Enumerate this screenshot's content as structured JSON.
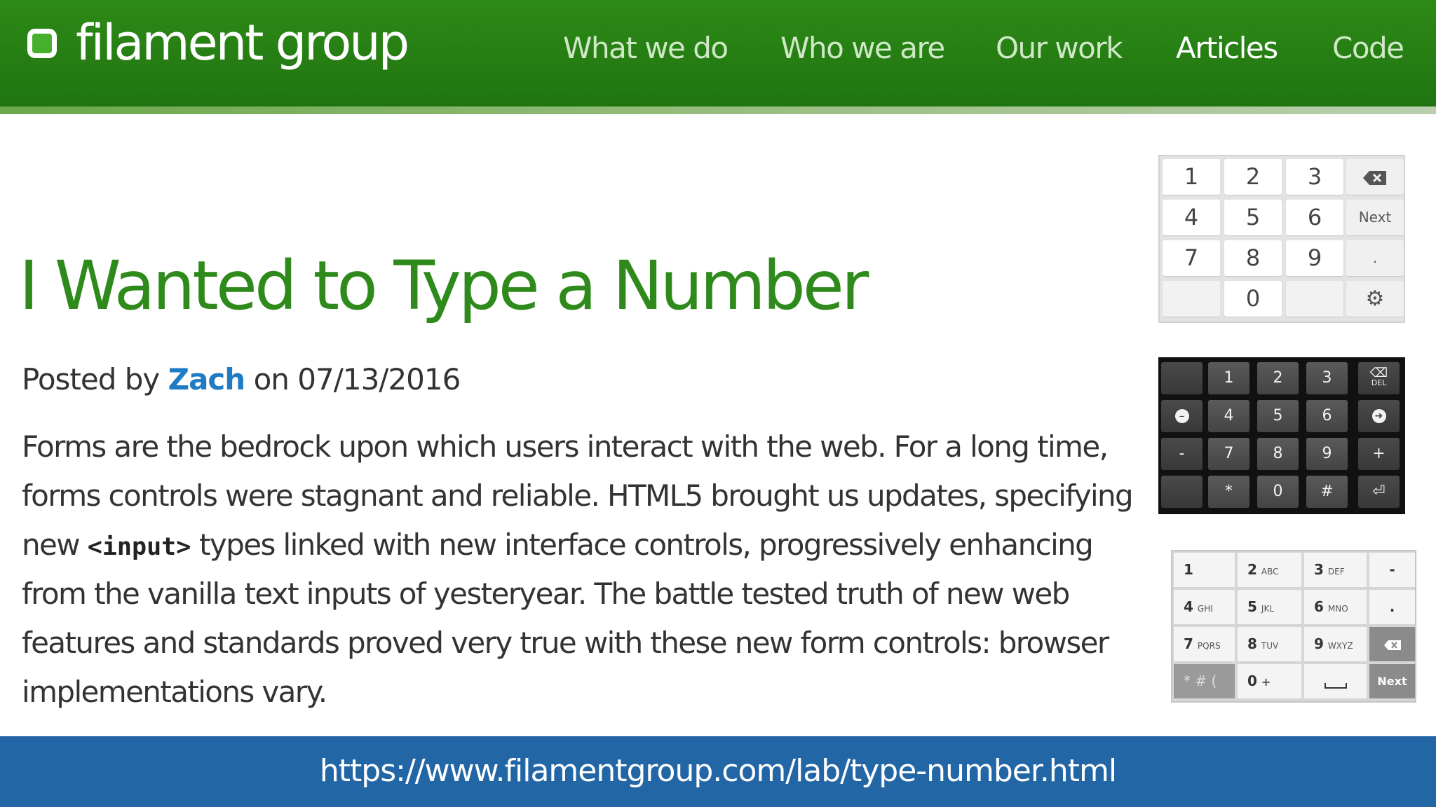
{
  "site": {
    "logo_text": "filament group",
    "brand_color": "#2e8a17",
    "nav": [
      {
        "label": "What we do",
        "active": false
      },
      {
        "label": "Who we are",
        "active": false
      },
      {
        "label": "Our work",
        "active": false
      },
      {
        "label": "Articles",
        "active": true
      },
      {
        "label": "Code",
        "active": false
      }
    ]
  },
  "article": {
    "title": "I Wanted to Type a Number",
    "byline_prefix": "Posted by",
    "author": "Zach",
    "byline_mid": "on",
    "date": "07/13/2016",
    "body_lines": [
      "Forms are the bedrock upon which users interact with the web. For a long time,",
      "forms controls were stagnant and reliable. HTML5 brought us updates, specifying",
      "types linked with new interface controls, progressively enhancing",
      "from the vanilla text inputs of yesteryear. The battle tested truth of new web",
      "features and standards proved very true with these new form controls: browser",
      "implementations vary."
    ],
    "line3_prefix": "new",
    "code_snippet": "<input>"
  },
  "keypads": {
    "light": {
      "rows": [
        [
          "1",
          "2",
          "3",
          "backspace-icon"
        ],
        [
          "4",
          "5",
          "6",
          "Next"
        ],
        [
          "7",
          "8",
          "9",
          "."
        ],
        [
          "",
          "0",
          "",
          "gear-icon"
        ]
      ]
    },
    "dark": {
      "rows": [
        [
          "",
          "1",
          "2",
          "3",
          "DEL"
        ],
        [
          "left-arrow-icon",
          "4",
          "5",
          "6",
          "right-arrow-icon"
        ],
        [
          "-",
          "7",
          "8",
          "9",
          "+"
        ],
        [
          "",
          "*",
          "0",
          "#",
          "enter-icon"
        ]
      ]
    },
    "gray": {
      "rows": [
        [
          {
            "d": "1",
            "l": ""
          },
          {
            "d": "2",
            "l": "ABC"
          },
          {
            "d": "3",
            "l": "DEF"
          },
          {
            "d": "-",
            "l": ""
          }
        ],
        [
          {
            "d": "4",
            "l": "GHI"
          },
          {
            "d": "5",
            "l": "JKL"
          },
          {
            "d": "6",
            "l": "MNO"
          },
          {
            "d": ".",
            "l": ""
          }
        ],
        [
          {
            "d": "7",
            "l": "PQRS"
          },
          {
            "d": "8",
            "l": "TUV"
          },
          {
            "d": "9",
            "l": "WXYZ"
          },
          {
            "d": "backspace-icon",
            "l": ""
          }
        ],
        [
          {
            "d": "* # (",
            "l": ""
          },
          {
            "d": "0",
            "l": "+"
          },
          {
            "d": "space-icon",
            "l": ""
          },
          {
            "d": "Next",
            "l": ""
          }
        ]
      ]
    }
  },
  "footer": {
    "url": "https://www.filamentgroup.com/lab/type-number.html",
    "color": "#2266a6"
  }
}
